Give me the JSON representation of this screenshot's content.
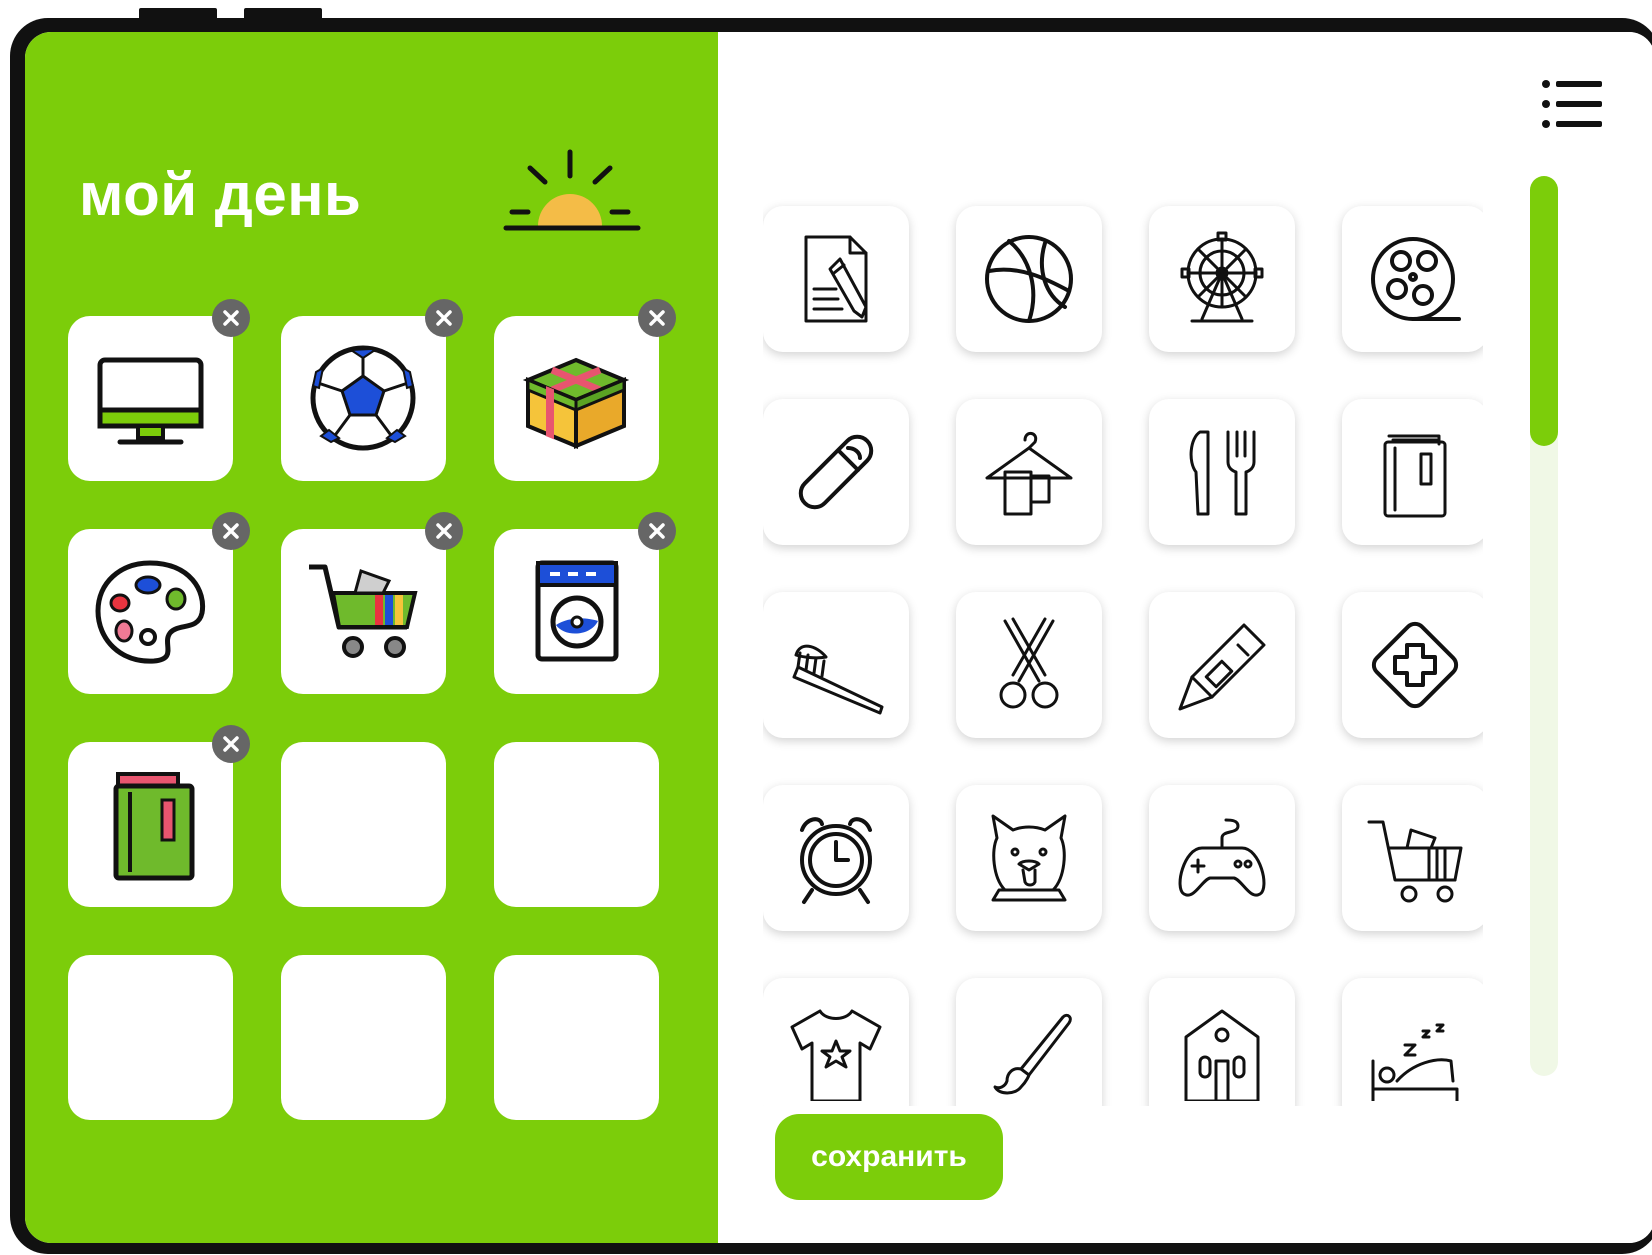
{
  "app": {
    "title": "мой день",
    "save_label": "сохранить",
    "colors": {
      "accent": "#7ccd0a",
      "panel_white": "#ffffff",
      "remove_badge": "#666666",
      "scroll_track": "#f0f8e6"
    }
  },
  "header": {
    "sun_icon": "sunrise-icon",
    "menu_icon": "menu-list-icon"
  },
  "day_plan": {
    "slots": [
      {
        "icon": "computer-monitor-icon",
        "filled": true
      },
      {
        "icon": "soccer-ball-icon",
        "filled": true
      },
      {
        "icon": "gift-box-icon",
        "filled": true
      },
      {
        "icon": "paint-palette-icon",
        "filled": true
      },
      {
        "icon": "shopping-cart-icon",
        "filled": true
      },
      {
        "icon": "washing-machine-icon",
        "filled": true
      },
      {
        "icon": "book-icon",
        "filled": true
      },
      {
        "icon": "",
        "filled": false
      },
      {
        "icon": "",
        "filled": false
      },
      {
        "icon": "",
        "filled": false
      },
      {
        "icon": "",
        "filled": false
      },
      {
        "icon": "",
        "filled": false
      }
    ],
    "remove_icon": "close-x-icon"
  },
  "library": {
    "items": [
      "document-edit-icon",
      "basketball-icon",
      "ferris-wheel-icon",
      "film-reel-icon",
      "pill-icon",
      "hanger-towel-icon",
      "knife-fork-icon",
      "book-icon",
      "toothbrush-icon",
      "scissors-icon",
      "utility-knife-icon",
      "first-aid-icon",
      "alarm-clock-icon",
      "pet-dog-icon",
      "gamepad-icon",
      "shopping-cart-icon",
      "tshirt-icon",
      "paint-brush-icon",
      "school-building-icon",
      "sleeping-bed-icon"
    ],
    "scroll_position": 0
  }
}
